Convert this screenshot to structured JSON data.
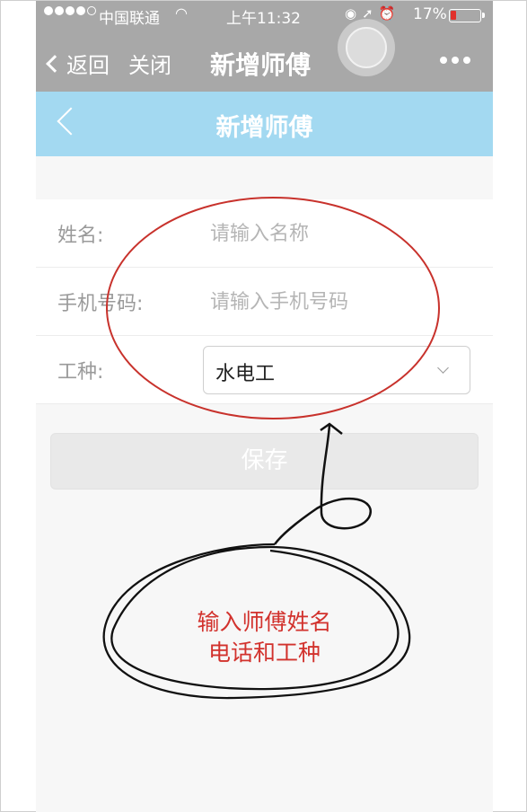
{
  "status_bar": {
    "carrier": "中国联通",
    "time": "上午11:32",
    "battery": "17%",
    "colors": {
      "battery_low": "#e0312b"
    }
  },
  "wechat_bar": {
    "back_label": "返回",
    "close_label": "关闭",
    "title": "新增师傅"
  },
  "page_header": {
    "title": "新增师傅",
    "background": "#a3d9f1"
  },
  "form": {
    "name": {
      "label": "姓名:",
      "placeholder": "请输入名称",
      "value": ""
    },
    "phone": {
      "label": "手机号码:",
      "placeholder": "请输入手机号码",
      "value": ""
    },
    "trade": {
      "label": "工种:",
      "selected": "水电工"
    },
    "save_label": "保存"
  },
  "annotation": {
    "line1": "输入师傅姓名",
    "line2": "电话和工种",
    "color": "#d2322d"
  }
}
